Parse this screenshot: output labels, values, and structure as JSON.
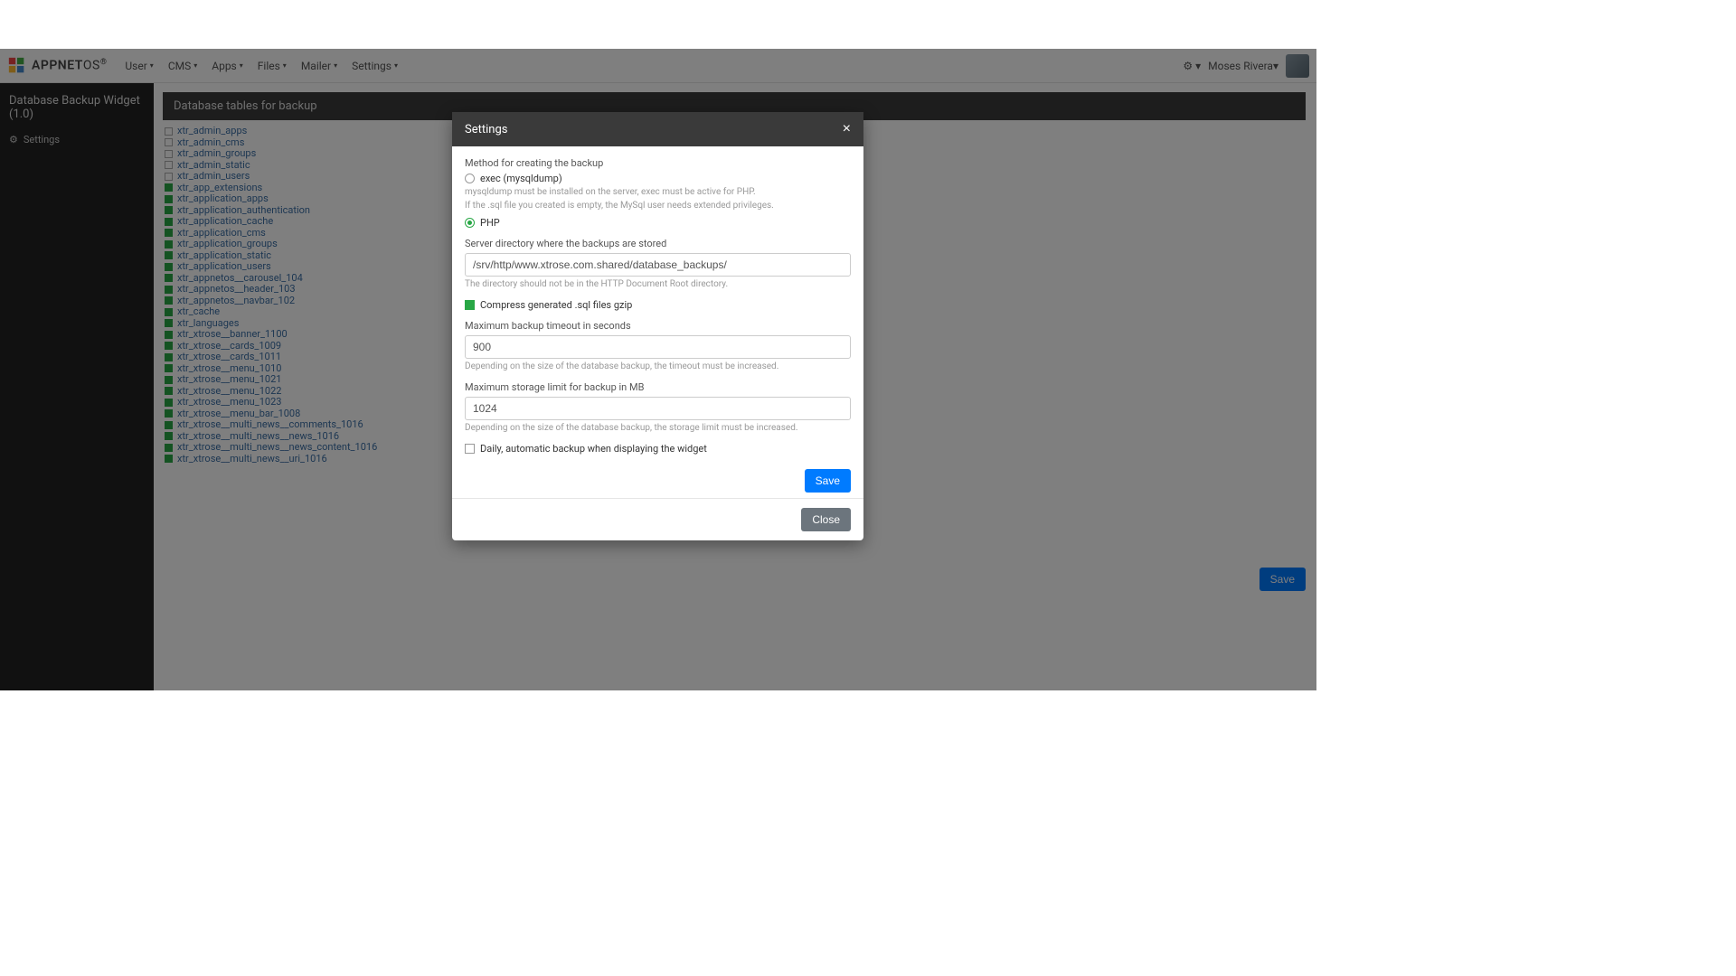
{
  "brand": {
    "name_part1": "APPNET",
    "name_part2": "OS",
    "reg": "®"
  },
  "nav": {
    "items": [
      "User",
      "CMS",
      "Apps",
      "Files",
      "Mailer",
      "Settings"
    ],
    "username": "Moses Rivera"
  },
  "sidebar": {
    "widget_title": "Database Backup Widget (1.0)",
    "settings_label": "Settings"
  },
  "main": {
    "panel_title": "Database tables for backup",
    "save_label": "Save",
    "tables": [
      {
        "name": "xtr_admin_apps",
        "checked": false
      },
      {
        "name": "xtr_admin_cms",
        "checked": false
      },
      {
        "name": "xtr_admin_groups",
        "checked": false
      },
      {
        "name": "xtr_admin_static",
        "checked": false
      },
      {
        "name": "xtr_admin_users",
        "checked": false
      },
      {
        "name": "xtr_app_extensions",
        "checked": true
      },
      {
        "name": "xtr_application_apps",
        "checked": true
      },
      {
        "name": "xtr_application_authentication",
        "checked": true
      },
      {
        "name": "xtr_application_cache",
        "checked": true
      },
      {
        "name": "xtr_application_cms",
        "checked": true
      },
      {
        "name": "xtr_application_groups",
        "checked": true
      },
      {
        "name": "xtr_application_static",
        "checked": true
      },
      {
        "name": "xtr_application_users",
        "checked": true
      },
      {
        "name": "xtr_appnetos__carousel_104",
        "checked": true
      },
      {
        "name": "xtr_appnetos__header_103",
        "checked": true
      },
      {
        "name": "xtr_appnetos__navbar_102",
        "checked": true
      },
      {
        "name": "xtr_cache",
        "checked": true
      },
      {
        "name": "xtr_languages",
        "checked": true
      },
      {
        "name": "xtr_xtrose__banner_1100",
        "checked": true
      },
      {
        "name": "xtr_xtrose__cards_1009",
        "checked": true
      },
      {
        "name": "xtr_xtrose__cards_1011",
        "checked": true
      },
      {
        "name": "xtr_xtrose__menu_1010",
        "checked": true
      },
      {
        "name": "xtr_xtrose__menu_1021",
        "checked": true
      },
      {
        "name": "xtr_xtrose__menu_1022",
        "checked": true
      },
      {
        "name": "xtr_xtrose__menu_1023",
        "checked": true
      },
      {
        "name": "xtr_xtrose__menu_bar_1008",
        "checked": true
      },
      {
        "name": "xtr_xtrose__multi_news__comments_1016",
        "checked": true
      },
      {
        "name": "xtr_xtrose__multi_news__news_1016",
        "checked": true
      },
      {
        "name": "xtr_xtrose__multi_news__news_content_1016",
        "checked": true
      },
      {
        "name": "xtr_xtrose__multi_news__uri_1016",
        "checked": true
      }
    ]
  },
  "modal": {
    "title": "Settings",
    "method_label": "Method for creating the backup",
    "method_exec": "exec (mysqldump)",
    "method_exec_help1": "mysqldump must be installed on the server, exec must be active for PHP.",
    "method_exec_help2": "If the .sql file you created is empty, the MySql user needs extended privileges.",
    "method_php": "PHP",
    "dir_label": "Server directory where the backups are stored",
    "dir_value": "/srv/http/www.xtrose.com.shared/database_backups/",
    "dir_help": "The directory should not be in the HTTP Document Root directory.",
    "compress_label": "Compress generated .sql files gzip",
    "timeout_label": "Maximum backup timeout in seconds",
    "timeout_value": "900",
    "timeout_help": "Depending on the size of the database backup, the timeout must be increased.",
    "storage_label": "Maximum storage limit for backup in MB",
    "storage_value": "1024",
    "storage_help": "Depending on the size of the database backup, the storage limit must be increased.",
    "daily_label": "Daily, automatic backup when displaying the widget",
    "save_label": "Save",
    "close_label": "Close"
  }
}
